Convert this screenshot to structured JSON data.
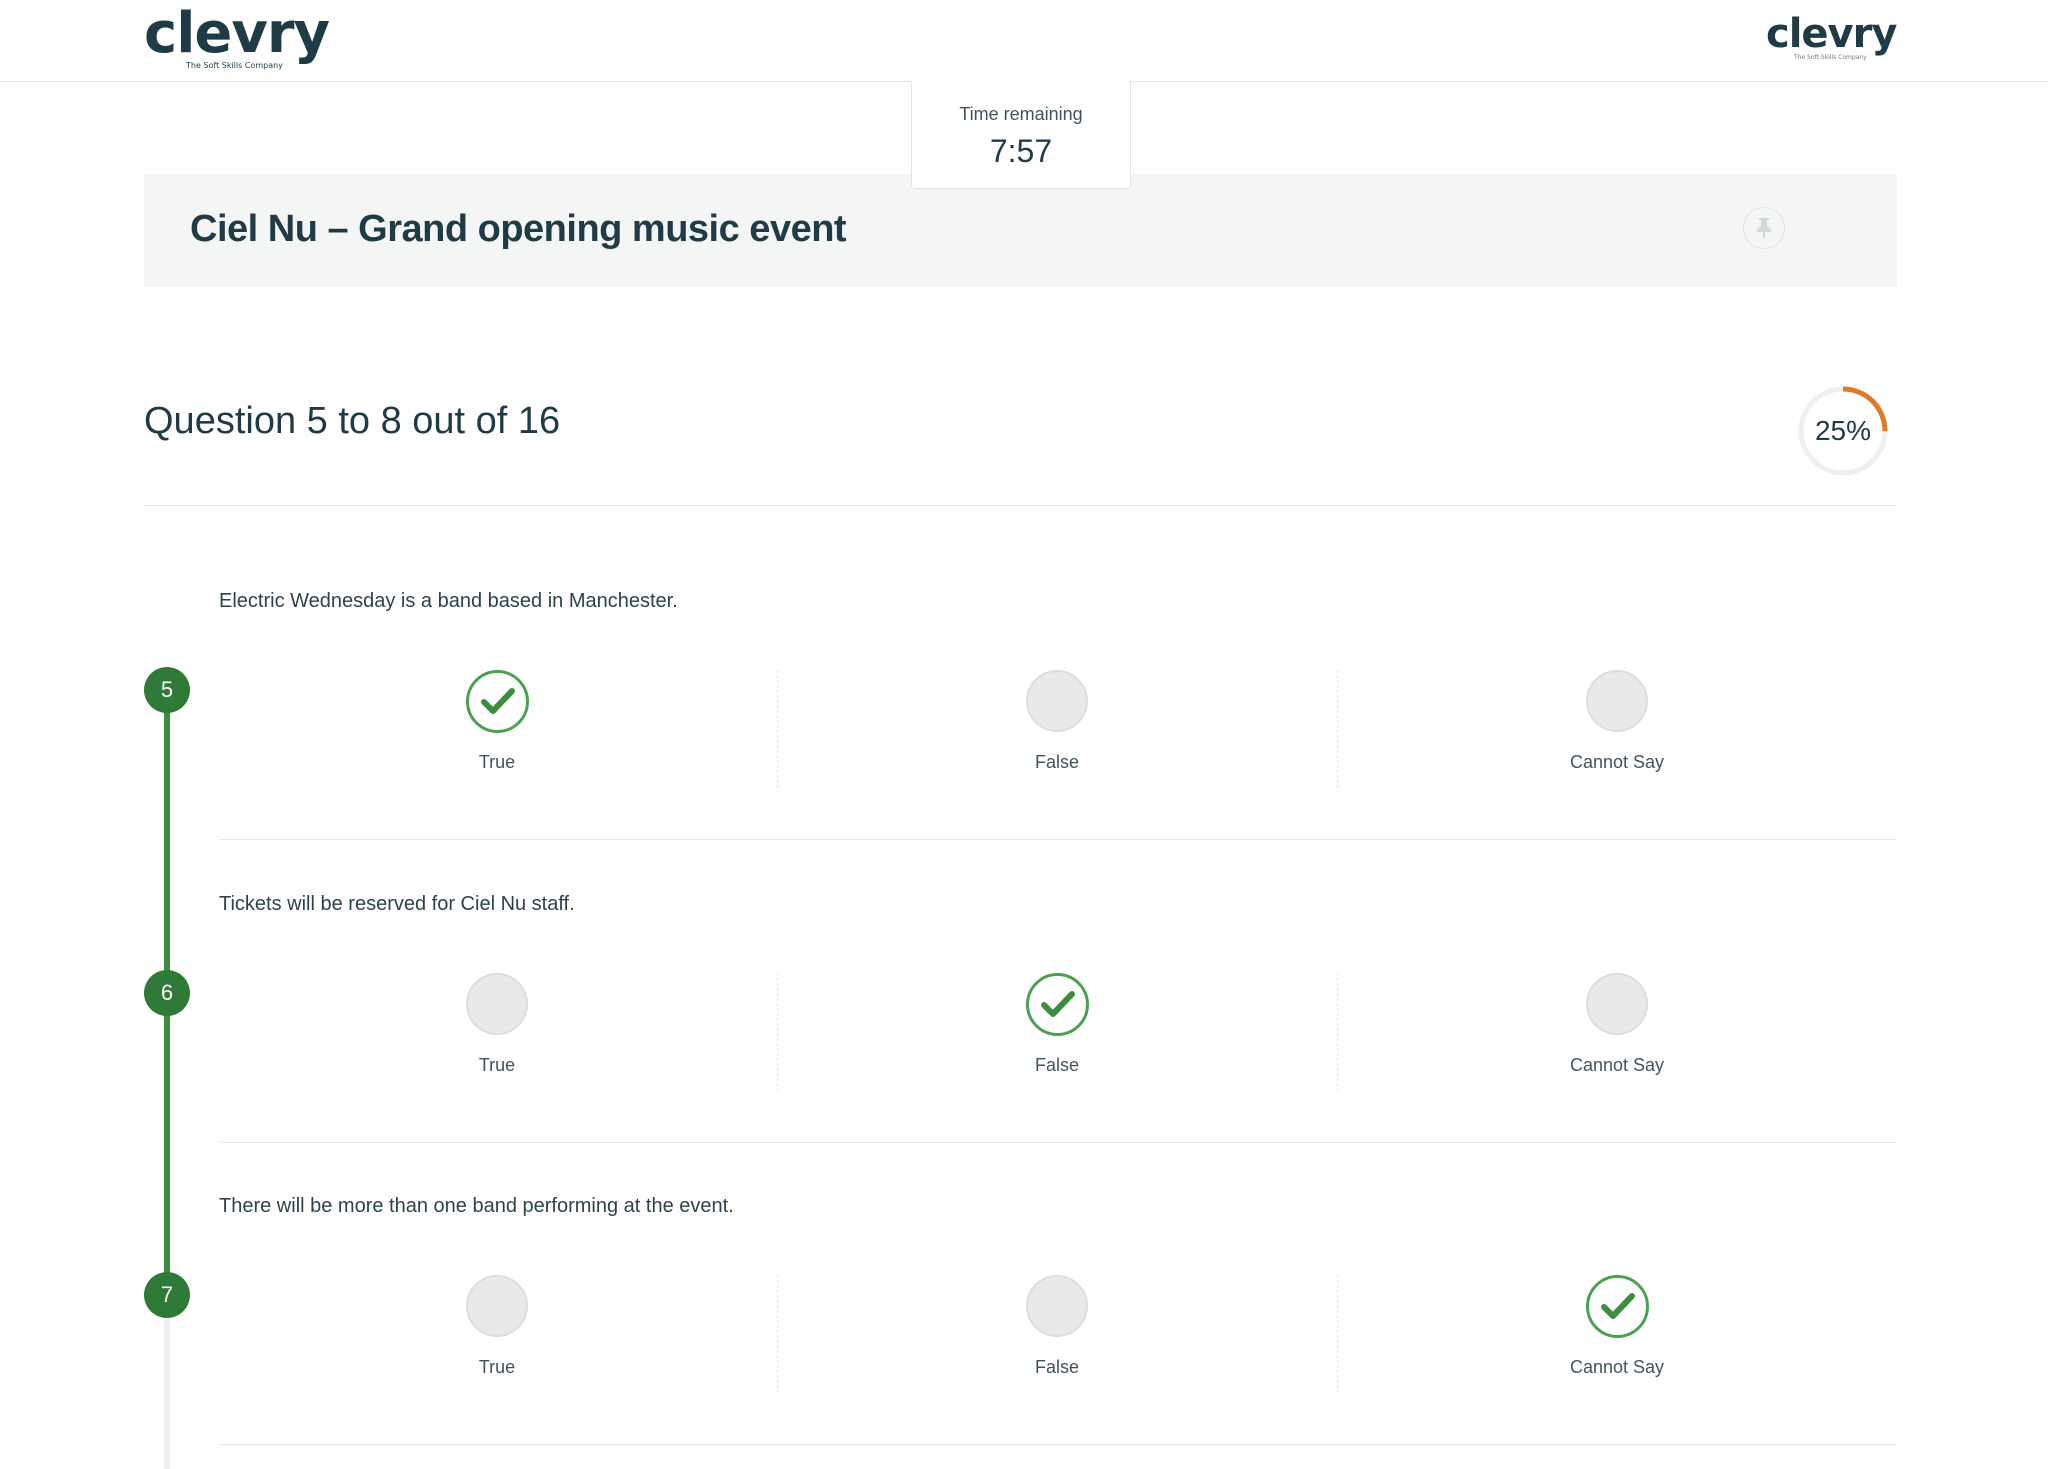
{
  "header": {
    "logo_left": {
      "name": "clevry",
      "tagline": "The Soft Skills Company"
    },
    "logo_right": {
      "name": "clevry",
      "tagline": "The Soft Skills Company"
    }
  },
  "timer": {
    "label": "Time remaining",
    "value": "7:57"
  },
  "section": {
    "title": "Ciel Nu – Grand opening music event"
  },
  "question_header": {
    "text": "Question 5 to 8 out of 16"
  },
  "progress": {
    "label": "25%",
    "value": 0.25,
    "color": "#e07b2a"
  },
  "colors": {
    "accent_green": "#3d8c40",
    "badge_green": "#2f7a36",
    "text_dark": "#1e3b46"
  },
  "questions": [
    {
      "number": "5",
      "statement": "Electric Wednesday is a band based in Manchester.",
      "options": [
        {
          "label": "True",
          "selected": true
        },
        {
          "label": "False",
          "selected": false
        },
        {
          "label": "Cannot Say",
          "selected": false
        }
      ]
    },
    {
      "number": "6",
      "statement": "Tickets will be reserved for Ciel Nu staff.",
      "options": [
        {
          "label": "True",
          "selected": false
        },
        {
          "label": "False",
          "selected": true
        },
        {
          "label": "Cannot Say",
          "selected": false
        }
      ]
    },
    {
      "number": "7",
      "statement": "There will be more than one band performing at the event.",
      "options": [
        {
          "label": "True",
          "selected": false
        },
        {
          "label": "False",
          "selected": false
        },
        {
          "label": "Cannot Say",
          "selected": true
        }
      ]
    }
  ]
}
